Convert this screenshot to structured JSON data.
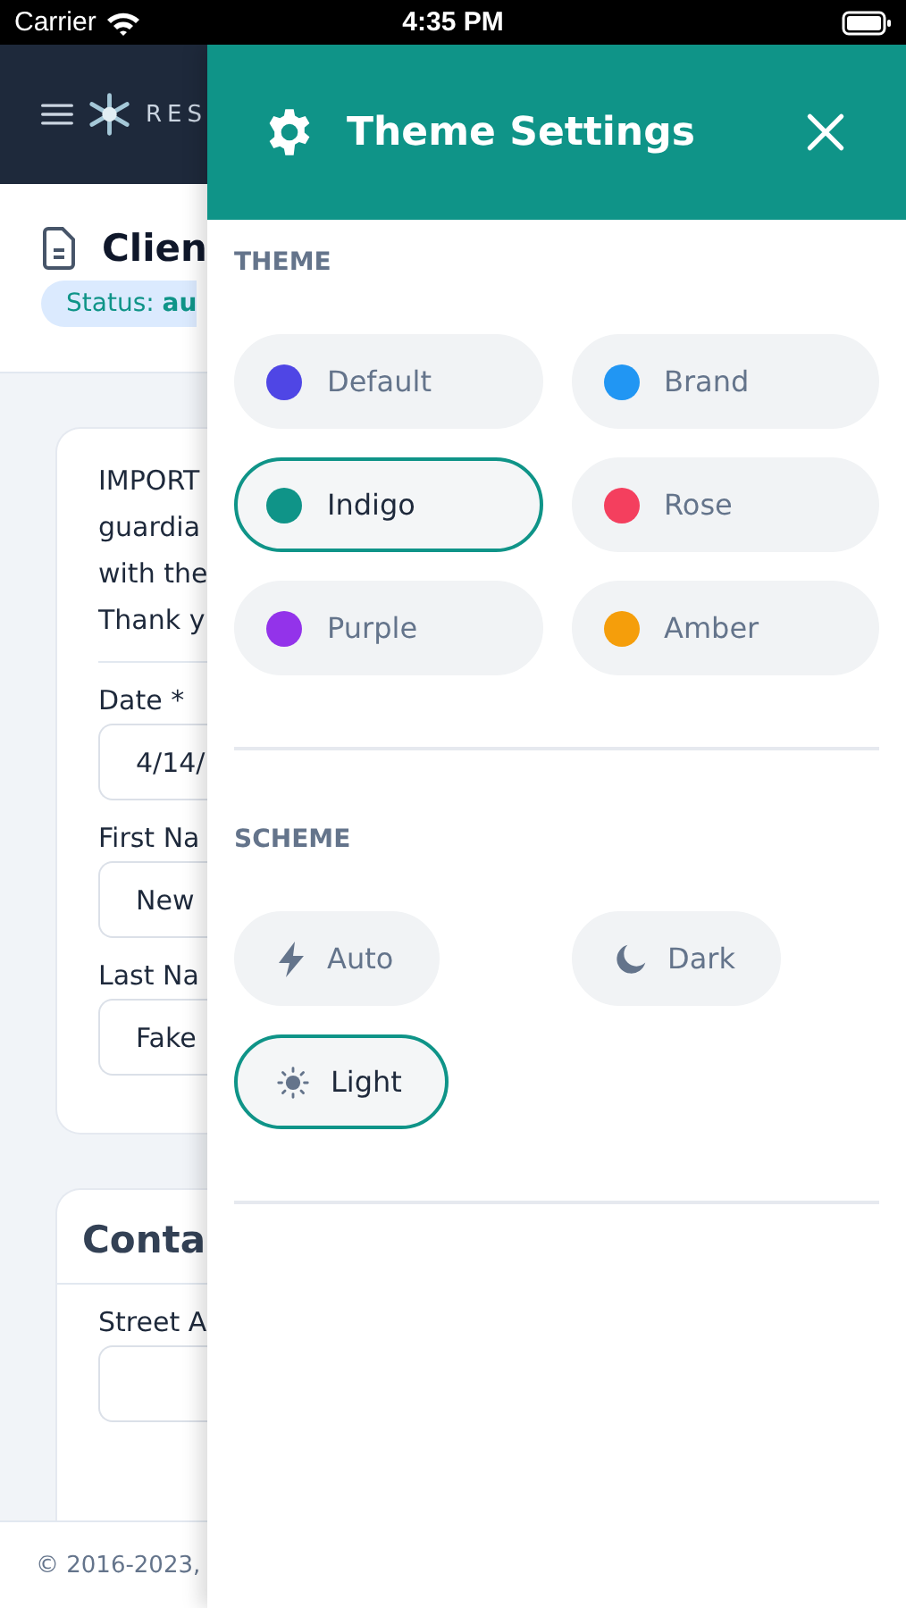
{
  "status_bar": {
    "carrier": "Carrier",
    "time": "4:35 PM"
  },
  "background_page": {
    "brand": "RES",
    "title": "Clien",
    "status": "Status: **au**",
    "notice_lines": [
      "IMPORT",
      "guardia",
      "with the",
      "Thank y"
    ],
    "fields": [
      {
        "label": "Date *",
        "value": "4/14/"
      },
      {
        "label": "First Na",
        "value": "New"
      },
      {
        "label": "Last Na",
        "value": "Fake"
      }
    ],
    "contact_heading": "Conta",
    "contact_fields": [
      {
        "label": "Street A"
      }
    ],
    "footer": "© 2016-2023,"
  },
  "drawer": {
    "title": "Theme Settings",
    "theme_heading": "THEME",
    "themes": [
      {
        "label": "Default",
        "color": "#4f46e5",
        "selected": false
      },
      {
        "label": "Brand",
        "color": "#2196f3",
        "selected": false
      },
      {
        "label": "Indigo",
        "color": "#0f9488",
        "selected": true
      },
      {
        "label": "Rose",
        "color": "#f43f5e",
        "selected": false
      },
      {
        "label": "Purple",
        "color": "#9333ea",
        "selected": false
      },
      {
        "label": "Amber",
        "color": "#f59e0b",
        "selected": false
      }
    ],
    "scheme_heading": "SCHEME",
    "schemes": [
      {
        "label": "Auto",
        "kind": "bolt",
        "selected": false
      },
      {
        "label": "Dark",
        "kind": "moon",
        "selected": false
      },
      {
        "label": "Light",
        "kind": "sun",
        "selected": true
      }
    ]
  }
}
